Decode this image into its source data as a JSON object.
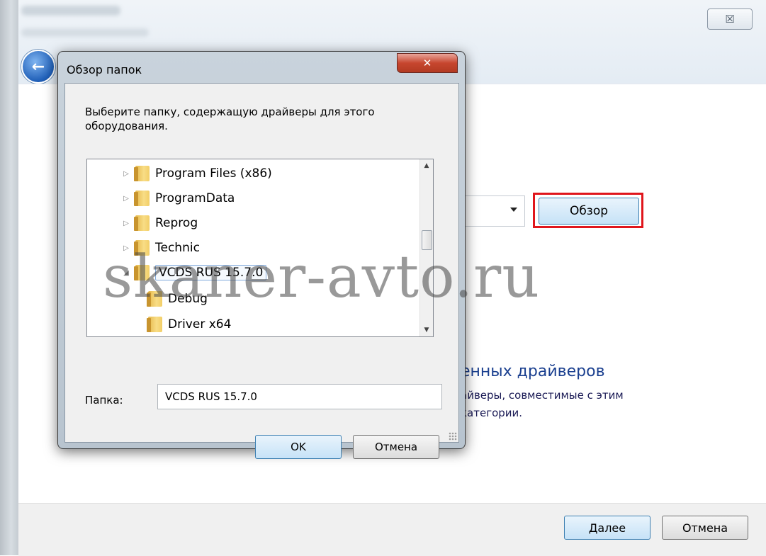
{
  "background_window": {
    "close_glyph": "☒",
    "back_glyph": "←",
    "browse_button_label": "Обзор",
    "highlight_color": "#e0161c",
    "link_section": {
      "title": "енных драйверов",
      "line1": "айверы, совместимые с этим",
      "line2": "категории."
    },
    "next_button_label": "Далее",
    "cancel_button_label": "Отмена"
  },
  "dialog": {
    "title": "Обзор папок",
    "close_glyph": "✕",
    "prompt": "Выберите папку, содержащую драйверы для этого оборудования.",
    "tree_items": [
      {
        "label": "Program Files (x86)",
        "expander": "▷",
        "selected": false
      },
      {
        "label": "ProgramData",
        "expander": "▷",
        "selected": false
      },
      {
        "label": "Reprog",
        "expander": "▷",
        "selected": false
      },
      {
        "label": "Technic",
        "expander": "▷",
        "selected": false
      },
      {
        "label": "VCDS RUS 15.7.0",
        "expander": "◢",
        "selected": true
      },
      {
        "label": "Debug",
        "expander": "",
        "selected": false
      },
      {
        "label": "Driver x64",
        "expander": "",
        "selected": false
      }
    ],
    "scroll_up_glyph": "▲",
    "scroll_down_glyph": "▼",
    "folder_label": "Папка:",
    "folder_value": "VCDS RUS 15.7.0",
    "ok_label": "OK",
    "cancel_label": "Отмена"
  },
  "watermark": "skaner-avto.ru"
}
